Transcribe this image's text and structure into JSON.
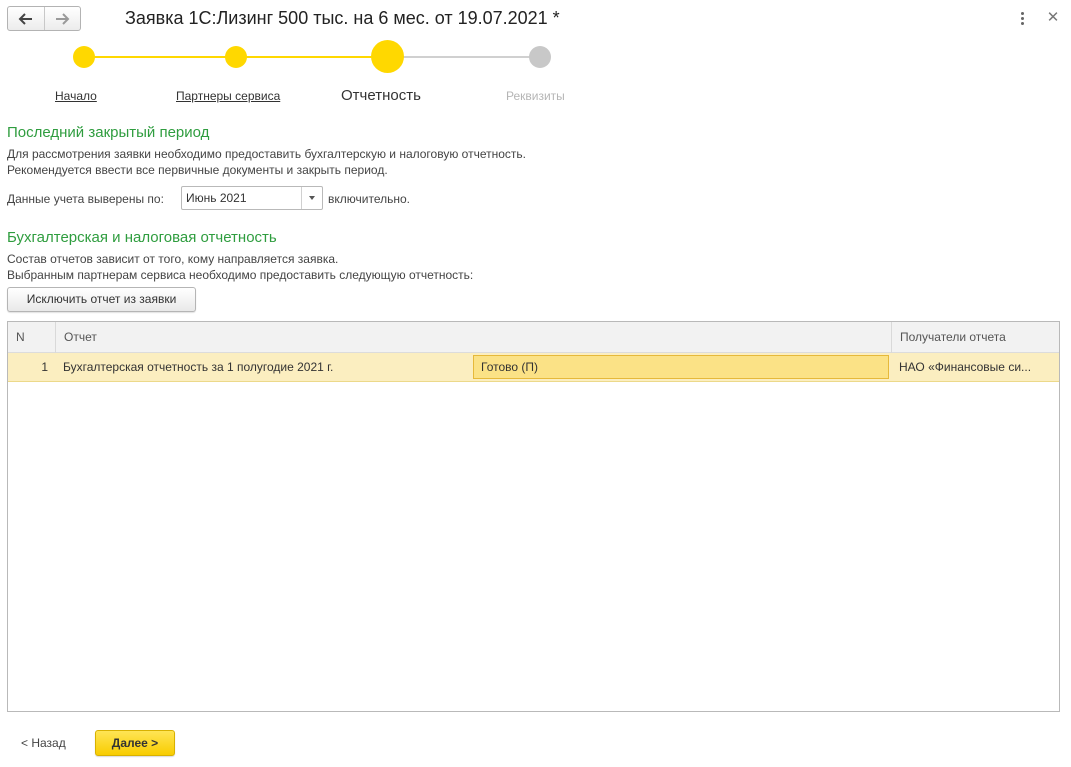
{
  "window": {
    "title": "Заявка 1С:Лизинг 500 тыс. на 6 мес. от 19.07.2021 *"
  },
  "colors": {
    "accent_yellow": "#ffd800",
    "inactive_step": "#c8c8c8",
    "section_green": "#2f9d3f",
    "selected_row": "#fbeec0"
  },
  "wizard": {
    "steps": [
      {
        "label": "Начало",
        "state": "done"
      },
      {
        "label": "Партнеры сервиса",
        "state": "done"
      },
      {
        "label": "Отчетность",
        "state": "current"
      },
      {
        "label": "Реквизиты",
        "state": "future"
      }
    ]
  },
  "period_section": {
    "title": "Последний закрытый период",
    "description_1": "Для рассмотрения заявки необходимо предоставить бухгалтерскую и налоговую отчетность.",
    "description_2": "Рекомендуется ввести все первичные документы и закрыть период.",
    "field_label": "Данные учета выверены по:",
    "field_value": "Июнь 2021",
    "field_suffix": "включительно."
  },
  "reports_section": {
    "title": "Бухгалтерская и налоговая отчетность",
    "description_1": "Состав отчетов зависит от того, кому направляется заявка.",
    "description_2": "Выбранным партнерам сервиса необходимо предоставить следующую отчетность:",
    "exclude_button": "Исключить отчет из заявки"
  },
  "table": {
    "columns": {
      "num": "N",
      "report": "Отчет",
      "recipients": "Получатели отчета"
    },
    "rows": [
      {
        "num": "1",
        "report": "Бухгалтерская отчетность за 1 полугодие 2021 г.",
        "status": "Готово (П)",
        "recipients": "НАО «Финансовые си..."
      }
    ]
  },
  "footer": {
    "back_label": "< Назад",
    "next_label": "Далее >"
  }
}
